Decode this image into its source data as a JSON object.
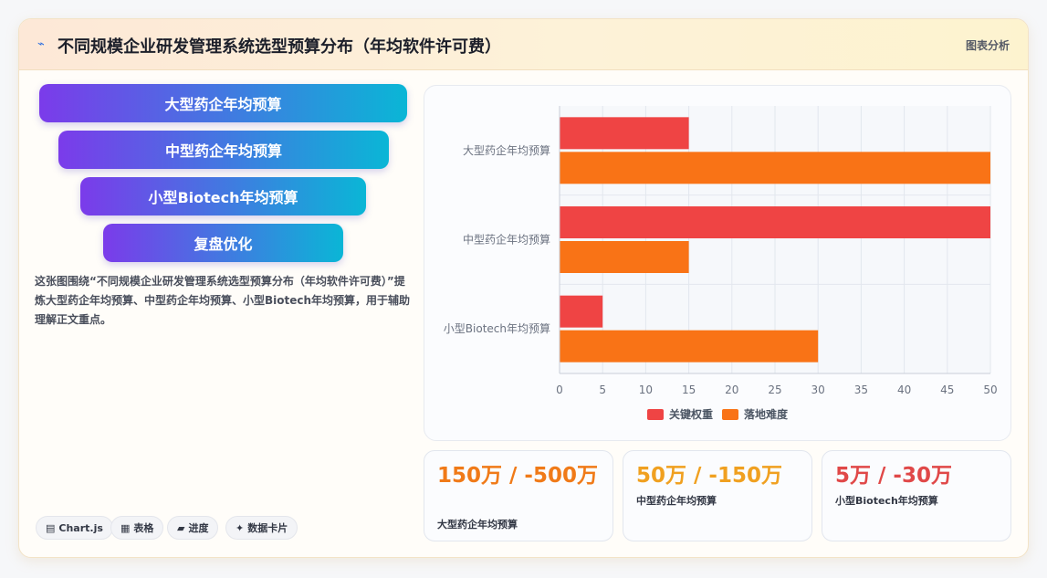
{
  "header": {
    "title_icon": "⌁",
    "title": "不同规模企业研发管理系统选型预算分布（年均软件许可费）",
    "tag": "图表分析"
  },
  "funnel": [
    {
      "label": "大型药企年均预算"
    },
    {
      "label": "中型药企年均预算"
    },
    {
      "label": "小型Biotech年均预算"
    },
    {
      "label": "复盘优化"
    }
  ],
  "description": "这张图围绕“不同规模企业研发管理系统选型预算分布（年均软件许可费）”提炼大型药企年均预算、中型药企年均预算、小型Biotech年均预算，用于辅助理解正文重点。",
  "chips": [
    {
      "icon": "▤",
      "label": "Chart.js"
    },
    {
      "icon": "▦",
      "label": "表格"
    },
    {
      "icon": "▰",
      "label": "进度"
    },
    {
      "icon": "✦",
      "label": "数据卡片"
    }
  ],
  "stats": [
    {
      "value": "150万 / -500万",
      "label": "大型药企年均预算",
      "color": "#f07a18"
    },
    {
      "value": "50万 / -150万",
      "label": "中型药企年均预算",
      "color": "#f0a020"
    },
    {
      "value": "5万 / -30万",
      "label": "小型Biotech年均预算",
      "color": "#e04848"
    }
  ],
  "chart_data": {
    "type": "bar",
    "orientation": "horizontal",
    "categories": [
      "大型药企年均预算",
      "中型药企年均预算",
      "小型Biotech年均预算"
    ],
    "series": [
      {
        "name": "关键权重",
        "values": [
          15,
          50,
          5
        ],
        "color": "#ef4444"
      },
      {
        "name": "落地难度",
        "values": [
          50,
          15,
          30
        ],
        "color": "#f97316"
      }
    ],
    "xlim": [
      0,
      50
    ],
    "xticks": [
      0,
      5,
      10,
      15,
      20,
      25,
      30,
      35,
      40,
      45,
      50
    ],
    "grid": true,
    "legend": "bottom"
  }
}
